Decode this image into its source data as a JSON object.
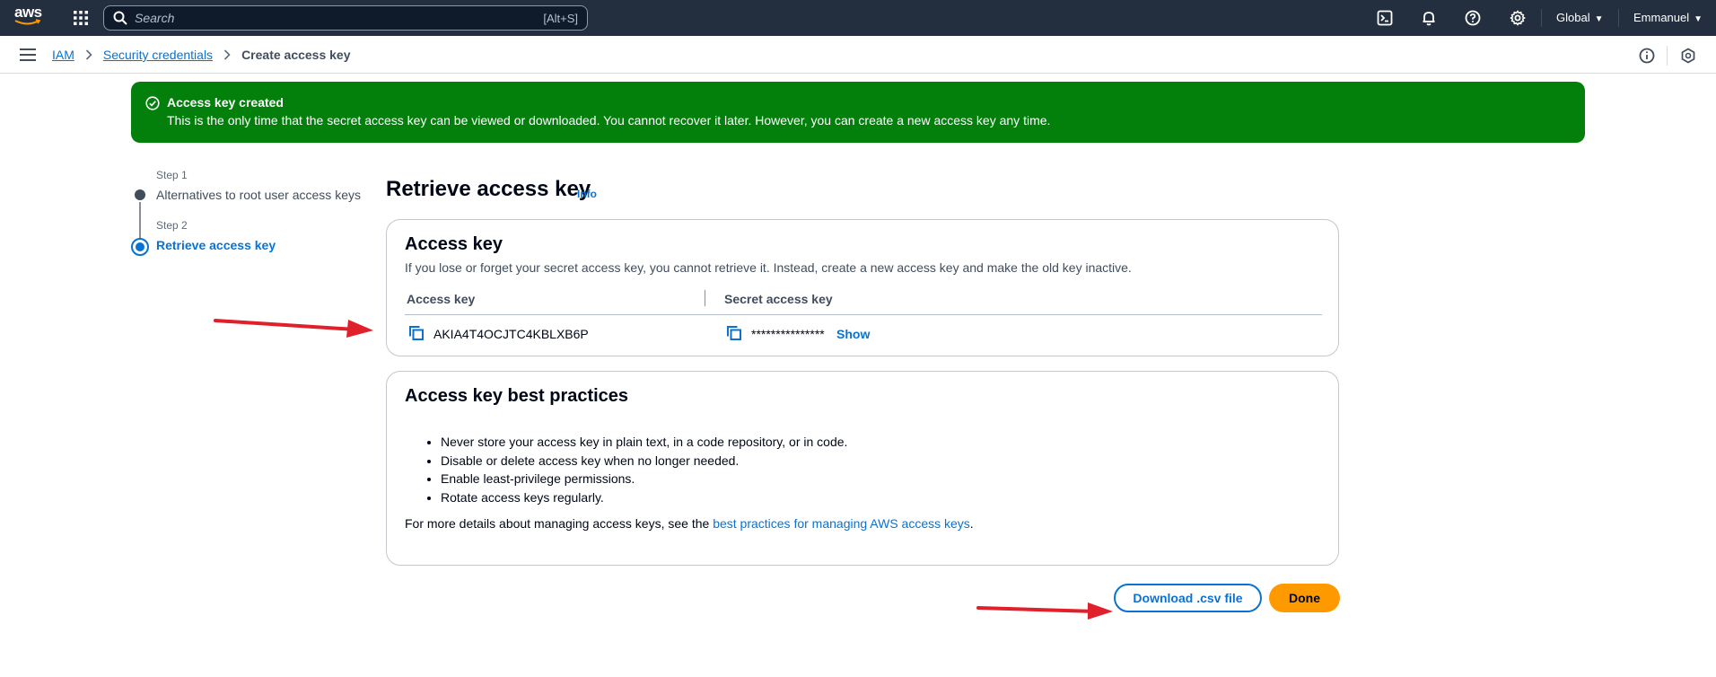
{
  "topnav": {
    "logo_text": "aws",
    "search_placeholder": "Search",
    "search_shortcut": "[Alt+S]",
    "region": "Global",
    "user": "Emmanuel",
    "icons": [
      "grid-icon",
      "cloudshell-icon",
      "bell-icon",
      "help-icon",
      "settings-icon"
    ]
  },
  "breadcrumb": {
    "items": [
      "IAM",
      "Security credentials"
    ],
    "current": "Create access key"
  },
  "flash": {
    "title": "Access key created",
    "message": "This is the only time that the secret access key can be viewed or downloaded. You cannot recover it later. However, you can create a new access key any time.",
    "color": "#037f0c"
  },
  "steps": [
    {
      "label": "Step 1",
      "title": "Alternatives to root user access keys"
    },
    {
      "label": "Step 2",
      "title": "Retrieve access key"
    }
  ],
  "page": {
    "title": "Retrieve access key",
    "info": "Info"
  },
  "access_key_card": {
    "title": "Access key",
    "description": "If you lose or forget your secret access key, you cannot retrieve it. Instead, create a new access key and make the old key inactive.",
    "col_access_key": "Access key",
    "col_secret_key": "Secret access key",
    "access_key_value": "AKIA4T4OCJTC4KBLXB6P",
    "secret_key_value": "***************",
    "show_label": "Show"
  },
  "best_practices": {
    "title": "Access key best practices",
    "items": [
      "Never store your access key in plain text, in a code repository, or in code.",
      "Disable or delete access key when no longer needed.",
      "Enable least-privilege permissions.",
      "Rotate access keys regularly."
    ],
    "footer_prefix": "For more details about managing access keys, see the ",
    "footer_link": "best practices for managing AWS access keys",
    "footer_suffix": "."
  },
  "actions": {
    "download": "Download .csv file",
    "done": "Done"
  },
  "colors": {
    "nav_bg": "#232f3e",
    "link": "#0972d3",
    "primary_button": "#ff9900",
    "annotation_arrow": "#e0202a"
  }
}
